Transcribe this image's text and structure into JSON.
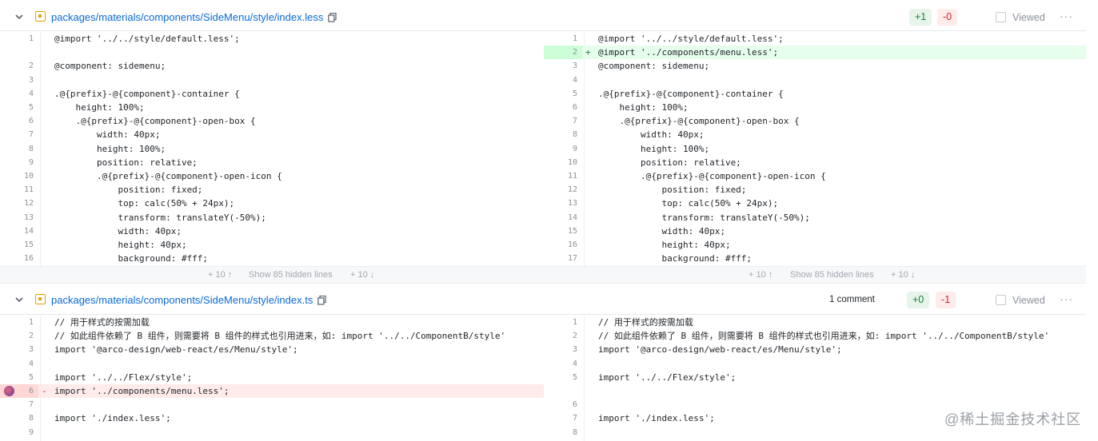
{
  "files": [
    {
      "path": "packages/materials/components/SideMenu/style/index.less",
      "additions": "+1",
      "deletions": "-0",
      "comments": "",
      "viewed_label": "Viewed",
      "left_lines": [
        {
          "n": "1",
          "code": "@import '../../style/default.less';",
          "type": "ctx"
        },
        {
          "n": "",
          "code": "",
          "type": "ctx"
        },
        {
          "n": "2",
          "code": "@component: sidemenu;",
          "type": "ctx"
        },
        {
          "n": "3",
          "code": "",
          "type": "ctx"
        },
        {
          "n": "4",
          "code": ".@{prefix}-@{component}-container {",
          "type": "ctx"
        },
        {
          "n": "5",
          "code": "    height: 100%;",
          "type": "ctx"
        },
        {
          "n": "6",
          "code": "    .@{prefix}-@{component}-open-box {",
          "type": "ctx"
        },
        {
          "n": "7",
          "code": "        width: 40px;",
          "type": "ctx"
        },
        {
          "n": "8",
          "code": "        height: 100%;",
          "type": "ctx"
        },
        {
          "n": "9",
          "code": "        position: relative;",
          "type": "ctx"
        },
        {
          "n": "10",
          "code": "        .@{prefix}-@{component}-open-icon {",
          "type": "ctx"
        },
        {
          "n": "11",
          "code": "            position: fixed;",
          "type": "ctx"
        },
        {
          "n": "12",
          "code": "            top: calc(50% + 24px);",
          "type": "ctx"
        },
        {
          "n": "13",
          "code": "            transform: translateY(-50%);",
          "type": "ctx"
        },
        {
          "n": "14",
          "code": "            width: 40px;",
          "type": "ctx"
        },
        {
          "n": "15",
          "code": "            height: 40px;",
          "type": "ctx"
        },
        {
          "n": "16",
          "code": "            background: #fff;",
          "type": "ctx"
        }
      ],
      "right_lines": [
        {
          "n": "1",
          "code": "@import '../../style/default.less';",
          "type": "ctx"
        },
        {
          "n": "2",
          "code": "@import '../components/menu.less';",
          "type": "add"
        },
        {
          "n": "3",
          "code": "@component: sidemenu;",
          "type": "ctx"
        },
        {
          "n": "4",
          "code": "",
          "type": "ctx"
        },
        {
          "n": "5",
          "code": ".@{prefix}-@{component}-container {",
          "type": "ctx"
        },
        {
          "n": "6",
          "code": "    height: 100%;",
          "type": "ctx"
        },
        {
          "n": "7",
          "code": "    .@{prefix}-@{component}-open-box {",
          "type": "ctx"
        },
        {
          "n": "8",
          "code": "        width: 40px;",
          "type": "ctx"
        },
        {
          "n": "9",
          "code": "        height: 100%;",
          "type": "ctx"
        },
        {
          "n": "10",
          "code": "        position: relative;",
          "type": "ctx"
        },
        {
          "n": "11",
          "code": "        .@{prefix}-@{component}-open-icon {",
          "type": "ctx"
        },
        {
          "n": "12",
          "code": "            position: fixed;",
          "type": "ctx"
        },
        {
          "n": "13",
          "code": "            top: calc(50% + 24px);",
          "type": "ctx"
        },
        {
          "n": "14",
          "code": "            transform: translateY(-50%);",
          "type": "ctx"
        },
        {
          "n": "15",
          "code": "            width: 40px;",
          "type": "ctx"
        },
        {
          "n": "16",
          "code": "            height: 40px;",
          "type": "ctx"
        },
        {
          "n": "17",
          "code": "            background: #fff;",
          "type": "ctx"
        }
      ],
      "hidden": {
        "up": "+ 10 ↑",
        "label": "Show 85 hidden lines",
        "down": "+ 10 ↓"
      }
    },
    {
      "path": "packages/materials/components/SideMenu/style/index.ts",
      "additions": "+0",
      "deletions": "-1",
      "comments": "1 comment",
      "viewed_label": "Viewed",
      "left_lines": [
        {
          "n": "1",
          "code": "// 用于样式的按需加载",
          "type": "ctx"
        },
        {
          "n": "2",
          "code": "// 如此组件依赖了 B 组件，则需要将 B 组件的样式也引用进来，如: import '../../ComponentB/style'",
          "type": "ctx"
        },
        {
          "n": "3",
          "code": "import '@arco-design/web-react/es/Menu/style';",
          "type": "ctx"
        },
        {
          "n": "4",
          "code": "",
          "type": "ctx"
        },
        {
          "n": "5",
          "code": "import '../../Flex/style';",
          "type": "ctx"
        },
        {
          "n": "6",
          "code": "import '../components/menu.less';",
          "type": "del"
        },
        {
          "n": "7",
          "code": "",
          "type": "ctx"
        },
        {
          "n": "8",
          "code": "import './index.less';",
          "type": "ctx"
        },
        {
          "n": "9",
          "code": "",
          "type": "ctx"
        }
      ],
      "right_lines": [
        {
          "n": "1",
          "code": "// 用于样式的按需加载",
          "type": "ctx"
        },
        {
          "n": "2",
          "code": "// 如此组件依赖了 B 组件，则需要将 B 组件的样式也引用进来，如: import '../../ComponentB/style'",
          "type": "ctx"
        },
        {
          "n": "3",
          "code": "import '@arco-design/web-react/es/Menu/style';",
          "type": "ctx"
        },
        {
          "n": "4",
          "code": "",
          "type": "ctx"
        },
        {
          "n": "5",
          "code": "import '../../Flex/style';",
          "type": "ctx"
        },
        {
          "n": "",
          "code": "",
          "type": "ctx"
        },
        {
          "n": "6",
          "code": "",
          "type": "ctx"
        },
        {
          "n": "7",
          "code": "import './index.less';",
          "type": "ctx"
        },
        {
          "n": "8",
          "code": "",
          "type": "ctx"
        }
      ]
    }
  ],
  "watermark": "@稀土掘金技术社区",
  "colors": {
    "link": "#0969da",
    "add_bg": "#e6ffec",
    "del_bg": "#ffebe9",
    "file_icon": "#e5a100"
  }
}
